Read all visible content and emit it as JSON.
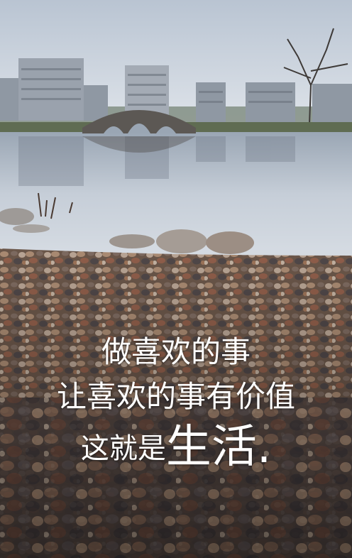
{
  "caption": {
    "line1": "做喜欢的事",
    "line2": "让喜欢的事有价值",
    "line3_prefix": "这就是",
    "line3_emphasis": "生活."
  },
  "colors": {
    "sky": "#c9d2de",
    "water": "#c3ccd6",
    "pebbles": "#6f5a4c",
    "text": "#ffffff"
  }
}
